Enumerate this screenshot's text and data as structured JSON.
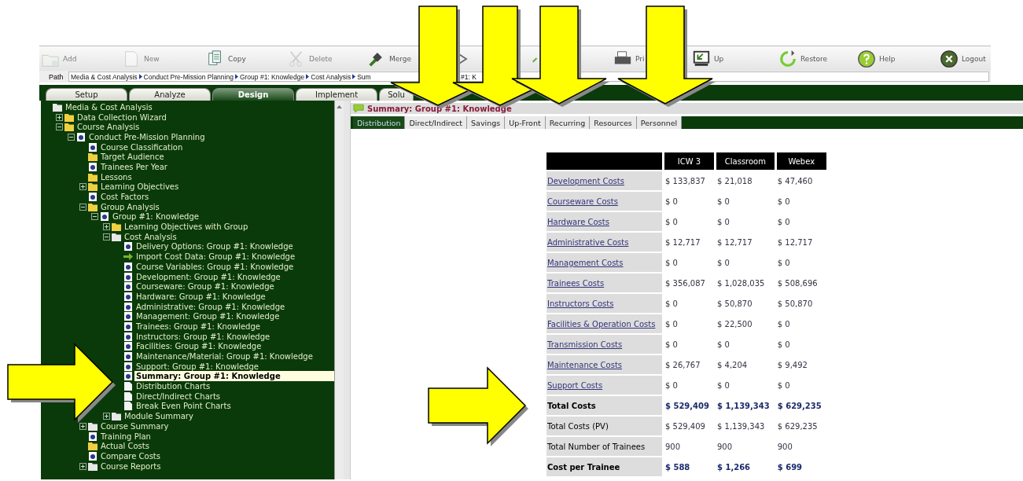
{
  "toolbar": {
    "items": [
      {
        "label": "Add",
        "disabled": true
      },
      {
        "label": "New",
        "disabled": true
      },
      {
        "label": "Copy",
        "disabled": false
      },
      {
        "label": "Delete",
        "disabled": true
      },
      {
        "label": "Merge",
        "disabled": false
      },
      {
        "disabled": false
      },
      {
        "disabled": false
      },
      {
        "label": "Pri",
        "disabled": false
      },
      {
        "label": "Up",
        "disabled": false
      },
      {
        "label": "Restore",
        "disabled": false
      },
      {
        "label": "Help",
        "disabled": false
      },
      {
        "label": "Logout",
        "disabled": false
      }
    ]
  },
  "path": {
    "label": "Path",
    "segments": [
      "Media & Cost Analysis",
      "Conduct Pre-Mission Planning",
      "Group #1: Knowledge",
      "Cost Analysis",
      "Sum"
    ],
    "tail": "#1: K"
  },
  "tabs": [
    {
      "label": "Setup",
      "selected": false
    },
    {
      "label": "Analyze",
      "selected": false
    },
    {
      "label": "Design",
      "selected": true
    },
    {
      "label": "Implement",
      "selected": false
    },
    {
      "label": "Solu",
      "selected": false
    }
  ],
  "tree": [
    {
      "label": "Media & Cost Analysis",
      "kind": "folder-white",
      "selected": false,
      "children": [
        {
          "label": "Data Collection Wizard",
          "kind": "folder",
          "expanded": false,
          "selected": false
        },
        {
          "label": "Course Analysis",
          "kind": "folder",
          "expanded": true,
          "selected": false,
          "children": [
            {
              "label": "Conduct Pre-Mission Planning",
              "kind": "page",
              "expanded": true,
              "selected": false,
              "children": [
                {
                  "label": "Course Classification",
                  "kind": "page",
                  "selected": false
                },
                {
                  "label": "Target Audience",
                  "kind": "folder",
                  "selected": false
                },
                {
                  "label": "Trainees Per Year",
                  "kind": "page",
                  "selected": false
                },
                {
                  "label": "Lessons",
                  "kind": "folder",
                  "selected": false
                },
                {
                  "label": "Learning Objectives",
                  "kind": "folder",
                  "expanded": false,
                  "selected": false
                },
                {
                  "label": "Cost Factors",
                  "kind": "page",
                  "selected": false
                },
                {
                  "label": "Group Analysis",
                  "kind": "folder",
                  "expanded": true,
                  "selected": false,
                  "children": [
                    {
                      "label": "Group #1: Knowledge",
                      "kind": "page",
                      "expanded": true,
                      "selected": false,
                      "children": [
                        {
                          "label": "Learning Objectives with Group",
                          "kind": "folder",
                          "expanded": false,
                          "selected": false
                        },
                        {
                          "label": "Cost Analysis",
                          "kind": "folder-white",
                          "expanded": true,
                          "selected": false,
                          "children": [
                            {
                              "label": "Delivery Options: Group #1: Knowledge",
                              "kind": "page",
                              "selected": false
                            },
                            {
                              "label": "Import Cost Data: Group #1: Knowledge",
                              "kind": "arrow",
                              "selected": false
                            },
                            {
                              "label": "Course Variables: Group #1: Knowledge",
                              "kind": "page",
                              "selected": false
                            },
                            {
                              "label": "Development: Group #1: Knowledge",
                              "kind": "page",
                              "selected": false
                            },
                            {
                              "label": "Courseware: Group #1: Knowledge",
                              "kind": "page",
                              "selected": false
                            },
                            {
                              "label": "Hardware: Group #1: Knowledge",
                              "kind": "page",
                              "selected": false
                            },
                            {
                              "label": "Administrative: Group #1: Knowledge",
                              "kind": "page",
                              "selected": false
                            },
                            {
                              "label": "Management: Group #1: Knowledge",
                              "kind": "page",
                              "selected": false
                            },
                            {
                              "label": "Trainees: Group #1: Knowledge",
                              "kind": "page",
                              "selected": false
                            },
                            {
                              "label": "Instructors: Group #1: Knowledge",
                              "kind": "page",
                              "selected": false
                            },
                            {
                              "label": "Facilities: Group #1: Knowledge",
                              "kind": "page",
                              "selected": false
                            },
                            {
                              "label": "Maintenance/Material: Group #1: Knowledge",
                              "kind": "page",
                              "selected": false
                            },
                            {
                              "label": "Support: Group #1: Knowledge",
                              "kind": "page",
                              "selected": false
                            },
                            {
                              "label": "Summary: Group #1: Knowledge",
                              "kind": "page",
                              "selected": true
                            },
                            {
                              "label": "Distribution Charts",
                              "kind": "blank",
                              "selected": false
                            },
                            {
                              "label": "Direct/Indirect Charts",
                              "kind": "blank",
                              "selected": false
                            },
                            {
                              "label": "Break Even Point Charts",
                              "kind": "blank",
                              "selected": false
                            }
                          ]
                        },
                        {
                          "label": "Module Summary",
                          "kind": "folder-white",
                          "expanded": false,
                          "selected": false
                        }
                      ]
                    }
                  ]
                },
                {
                  "label": "Course Summary",
                  "kind": "folder-white",
                  "expanded": false,
                  "selected": false
                },
                {
                  "label": "Training Plan",
                  "kind": "page",
                  "selected": false
                },
                {
                  "label": "Actual Costs",
                  "kind": "folder",
                  "selected": false
                },
                {
                  "label": "Compare Costs",
                  "kind": "page",
                  "selected": false
                },
                {
                  "label": "Course Reports",
                  "kind": "folder-white",
                  "expanded": false,
                  "selected": false
                }
              ]
            }
          ]
        }
      ]
    }
  ],
  "content": {
    "title": "Summary: Group #1: Knowledge",
    "subtabs": [
      {
        "label": "Distribution",
        "selected": true
      },
      {
        "label": "Direct/Indirect",
        "selected": false
      },
      {
        "label": "Savings",
        "selected": false
      },
      {
        "label": "Up-Front",
        "selected": false
      },
      {
        "label": "Recurring",
        "selected": false
      },
      {
        "label": "Resources",
        "selected": false
      },
      {
        "label": "Personnel",
        "selected": false
      }
    ],
    "table": {
      "columns": [
        "ICW 3",
        "Classroom",
        "Webex"
      ],
      "rows": [
        {
          "kind": "link",
          "label": "Development Costs",
          "values": [
            "$ 133,837",
            "$ 21,018",
            "$ 47,460"
          ]
        },
        {
          "kind": "link",
          "label": "Courseware Costs",
          "values": [
            "$ 0",
            "$ 0",
            "$ 0"
          ]
        },
        {
          "kind": "link",
          "label": "Hardware Costs",
          "values": [
            "$ 0",
            "$ 0",
            "$ 0"
          ]
        },
        {
          "kind": "link",
          "label": "Administrative Costs",
          "values": [
            "$ 12,717",
            "$ 12,717",
            "$ 12,717"
          ]
        },
        {
          "kind": "link",
          "label": "Management Costs",
          "values": [
            "$ 0",
            "$ 0",
            "$ 0"
          ]
        },
        {
          "kind": "link",
          "label": "Trainees Costs",
          "values": [
            "$ 356,087",
            "$ 1,028,035",
            "$ 508,696"
          ]
        },
        {
          "kind": "link",
          "label": "Instructors Costs",
          "values": [
            "$ 0",
            "$ 50,870",
            "$ 50,870"
          ]
        },
        {
          "kind": "link",
          "label": "Facilities & Operation Costs",
          "values": [
            "$ 0",
            "$ 22,500",
            "$ 0"
          ]
        },
        {
          "kind": "link",
          "label": "Transmission Costs",
          "values": [
            "$ 0",
            "$ 0",
            "$ 0"
          ]
        },
        {
          "kind": "link",
          "label": "Maintenance Costs",
          "values": [
            "$ 26,767",
            "$ 4,204",
            "$ 9,492"
          ]
        },
        {
          "kind": "link",
          "label": "Support Costs",
          "values": [
            "$ 0",
            "$ 0",
            "$ 0"
          ]
        },
        {
          "kind": "total",
          "label": "Total Costs",
          "values": [
            "$ 529,409",
            "$ 1,139,343",
            "$ 629,235"
          ]
        },
        {
          "kind": "plain",
          "label": "Total Costs (PV)",
          "values": [
            "$ 529,409",
            "$ 1,139,343",
            "$ 629,235"
          ]
        },
        {
          "kind": "plain",
          "label": "Total Number of Trainees",
          "values": [
            "900",
            "900",
            "900"
          ]
        },
        {
          "kind": "total",
          "label": "Cost per Trainee",
          "values": [
            "$ 588",
            "$ 1,266",
            "$ 699"
          ]
        }
      ]
    }
  }
}
